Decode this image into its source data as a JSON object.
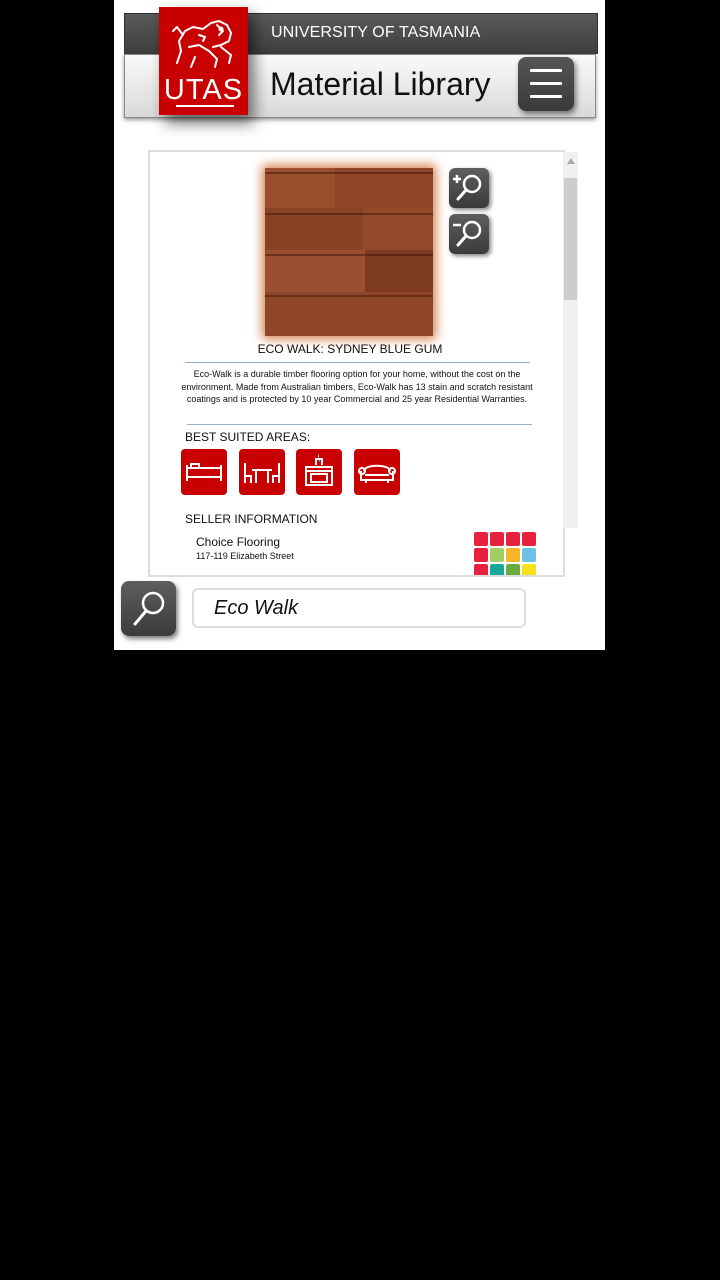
{
  "header": {
    "university": "UNIVERSITY OF TASMANIA",
    "title": "Material Library",
    "logo_text": "UTAS"
  },
  "product": {
    "name": "ECO WALK: SYDNEY BLUE GUM",
    "description": "Eco-Walk is a durable timber flooring option for your home, without the cost on the environment.  Made from Australian timbers, Eco-Walk has 13 stain and scratch resistant coatings and is protected by 10 year Commercial and 25 year Residential Warranties."
  },
  "areas": {
    "label": "BEST SUITED AREAS:",
    "items": [
      "bed-icon",
      "dining-table-icon",
      "kitchen-stove-icon",
      "sofa-icon"
    ]
  },
  "seller": {
    "label": "SELLER INFORMATION",
    "name": "Choice Flooring",
    "address": "117-119 Elizabeth Street"
  },
  "search": {
    "value": "Eco Walk"
  },
  "colors": {
    "brand_red": "#c80000",
    "header_dark": "#4a4a4a",
    "button_dark": "#4a4a4a"
  }
}
